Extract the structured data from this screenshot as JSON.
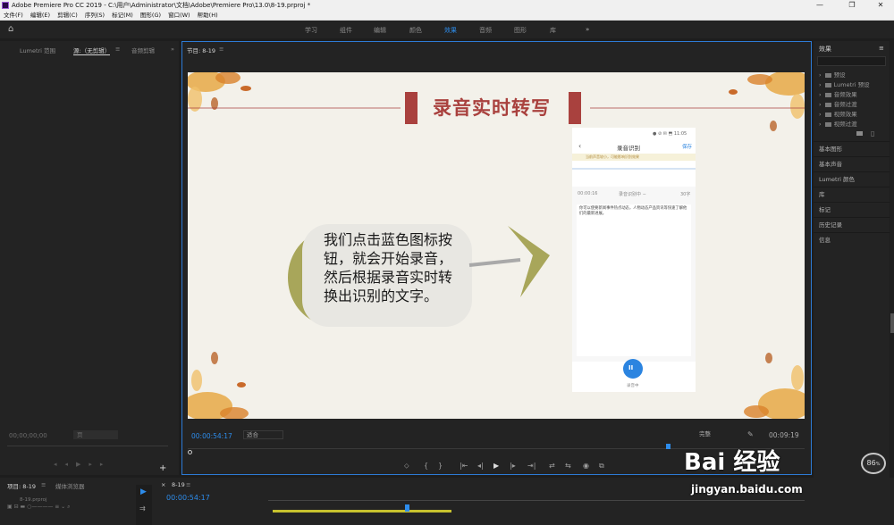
{
  "window": {
    "title": "Adobe Premiere Pro CC 2019 - C:\\用户\\Administrator\\文档\\Adobe\\Premiere Pro\\13.0\\8-19.prproj *",
    "minimize": "—",
    "maximize": "❐",
    "close": "✕"
  },
  "menu": [
    "文件(F)",
    "编辑(E)",
    "剪辑(C)",
    "序列(S)",
    "标记(M)",
    "图形(G)",
    "窗口(W)",
    "帮助(H)"
  ],
  "workspaces": {
    "home_icon": "home-icon",
    "items": [
      "学习",
      "组件",
      "编辑",
      "颜色",
      "效果",
      "音频",
      "图形",
      "库"
    ],
    "active": "效果",
    "more": "»"
  },
  "source_panel": {
    "tabs": [
      "Lumetri 范围",
      "源:（无剪辑）",
      "音频剪辑"
    ],
    "menu_glyph": "≡",
    "more": "»",
    "timecode": "00;00;00;00",
    "page_label": "页"
  },
  "program_panel": {
    "tab": "节目: 8-19",
    "menu_glyph": "≡",
    "timecode": "00:00:54:17",
    "fit": "适合",
    "quality": "完整",
    "duration": "00:09:19"
  },
  "slide": {
    "title": "录音实时转写",
    "bubble_text": "我们点击蓝色图标按钮，就会开始录音，然后根据录音实时转换出识别的文字。",
    "phone": {
      "status": "● ⊘ ✉ ⬒ 11:05",
      "header": "录音识别",
      "save": "保存",
      "notice": "当前声音较小，可能影响识别效果",
      "timer": "00:00:16",
      "recording_label": "录音识别中 ∽",
      "count": "30字",
      "transcript": "你可以使要新闻事件热点动态，人物动态产品资讯等快速了解他们的最新进展。",
      "status_text": "录音中",
      "pause_button": "II"
    }
  },
  "transport": [
    "⬦",
    "{",
    "}",
    "|⇤",
    "◂|",
    "▶",
    "|▸",
    "⇥|",
    "⇄",
    "⇆",
    "◉",
    "⧉"
  ],
  "effects_panel": {
    "title": "效果",
    "menu_glyph": "≡",
    "tree": [
      "预设",
      "Lumetri 预设",
      "音频效果",
      "音频过渡",
      "视频效果",
      "视频过渡"
    ],
    "panels": [
      "基本图形",
      "基本声音",
      "Lumetri 颜色",
      "库",
      "标记",
      "历史记录",
      "信息"
    ]
  },
  "project_panel": {
    "tabs": [
      "项目: 8-19",
      "媒体浏览器"
    ],
    "menu_glyph": "≡",
    "file": "8-19.prproj"
  },
  "timeline_panel": {
    "tab": "8-19",
    "menu_glyph": "≡",
    "timecode": "00:00:54:17"
  },
  "tools": {
    "selection": "▶",
    "add": "+"
  },
  "badge": "86",
  "watermark": {
    "logo": "Bai 经验",
    "url": "jingyan.baidu.com"
  },
  "colors": {
    "accent_blue": "#2d8ceb",
    "slide_title": "#a9413e",
    "olive": "#a8a65a"
  }
}
